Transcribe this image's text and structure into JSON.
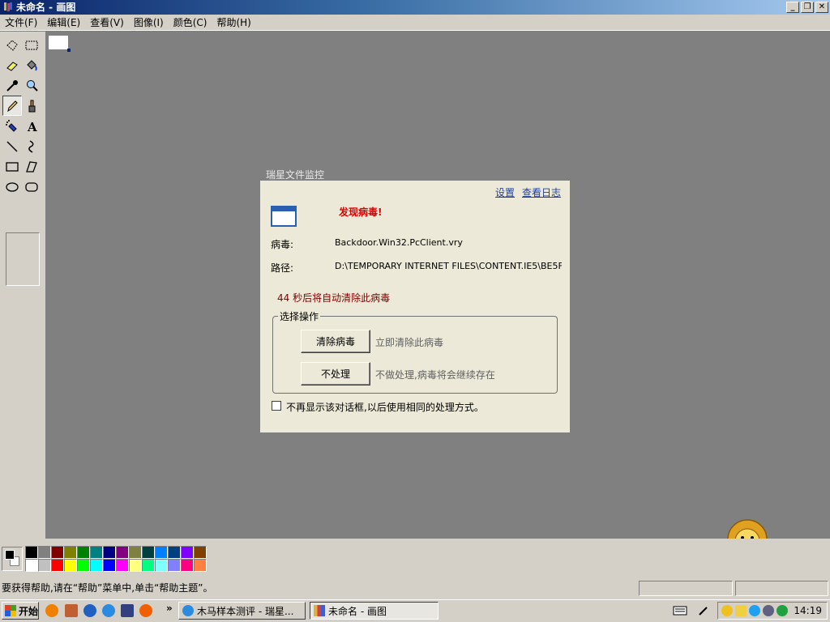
{
  "window": {
    "title": "未命名 - 画图",
    "buttons": {
      "minimize": "_",
      "restore": "❐",
      "close": "✕"
    }
  },
  "menubar": {
    "items": [
      "文件(F)",
      "编辑(E)",
      "查看(V)",
      "图像(I)",
      "颜色(C)",
      "帮助(H)"
    ]
  },
  "toolbox": {
    "tools": [
      "free-select-icon",
      "rect-select-icon",
      "eraser-icon",
      "fill-bucket-icon",
      "color-picker-icon",
      "magnifier-icon",
      "pencil-icon",
      "brush-icon",
      "airbrush-icon",
      "text-icon",
      "line-icon",
      "curve-icon",
      "rectangle-icon",
      "polygon-icon",
      "ellipse-icon",
      "rounded-rect-icon"
    ],
    "selected": "pencil-icon"
  },
  "dialog": {
    "caption": "瑞星文件监控",
    "settings_link": "设置",
    "log_link": "查看日志",
    "alert": "发现病毒!",
    "virus_label": "病毒:",
    "virus_value": "Backdoor.Win32.PcClient.vry",
    "path_label": "路径:",
    "path_value": "D:\\TEMPORARY INTERNET FILES\\CONTENT.IE5\\BE5F",
    "countdown": "44 秒后将自动清除此病毒",
    "group_label": "选择操作",
    "clean_button": "清除病毒",
    "clean_desc": "立即清除此病毒",
    "ignore_button": "不处理",
    "ignore_desc": "不做处理,病毒将会继续存在",
    "checkbox_label": "不再显示该对话框,以后使用相同的处理方式。",
    "checkbox_checked": false
  },
  "palette": {
    "foreground": "#000000",
    "background": "#ffffff",
    "colors": [
      "#000000",
      "#808080",
      "#800000",
      "#808000",
      "#008000",
      "#008080",
      "#000080",
      "#800080",
      "#808040",
      "#004040",
      "#0080ff",
      "#004080",
      "#8000ff",
      "#804000",
      "#ffffff",
      "#c0c0c0",
      "#ff0000",
      "#ffff00",
      "#00ff00",
      "#00ffff",
      "#0000ff",
      "#ff00ff",
      "#ffff80",
      "#00ff80",
      "#80ffff",
      "#8080ff",
      "#ff0080",
      "#ff8040"
    ]
  },
  "statusbar": {
    "help_text": "要获得帮助,请在“帮助”菜单中,单击“帮助主题”。"
  },
  "taskbar": {
    "start_label": "开始",
    "quicklaunch_more": "»",
    "tasks": [
      {
        "label": "木马样本测评 - 瑞星...",
        "active": false
      },
      {
        "label": "未命名 - 画图",
        "active": true
      }
    ],
    "clock": "14:19"
  }
}
